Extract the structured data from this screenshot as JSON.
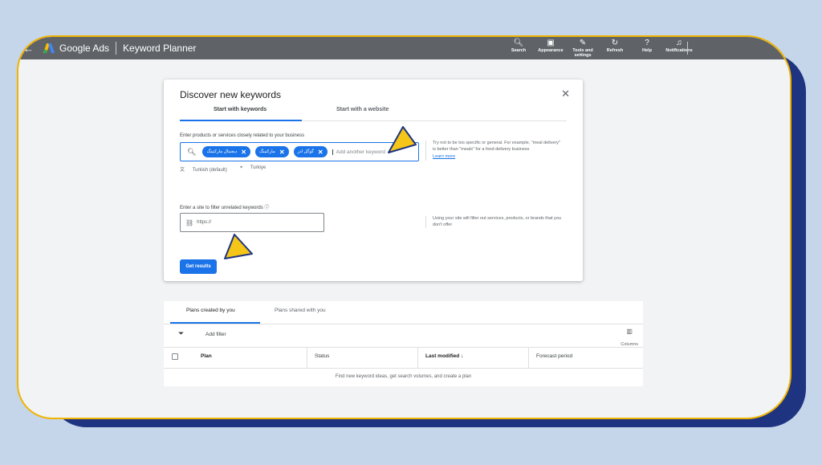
{
  "header": {
    "brand": "Google Ads",
    "product": "Keyword Planner",
    "actions": [
      {
        "icon": "search-icon",
        "label": "Search"
      },
      {
        "icon": "appearance-icon",
        "label": "Appearance"
      },
      {
        "icon": "wrench-icon",
        "label": "Tools and settings"
      },
      {
        "icon": "refresh-icon",
        "label": "Refresh"
      },
      {
        "icon": "help-icon",
        "label": "Help"
      },
      {
        "icon": "bell-icon",
        "label": "Notifications"
      }
    ]
  },
  "dialog": {
    "title": "Discover new keywords",
    "tabs": [
      "Start with keywords",
      "Start with a website"
    ],
    "products_label": "Enter products or services closely related to your business",
    "chips": [
      "دیجیتال مارکتینگ",
      "مارکتینگ",
      "گوگل ادز"
    ],
    "keyword_placeholder": "Add another keyword",
    "language": "Turkish (default)",
    "location": "Turkiye",
    "hint1": "Try not to be too specific or general. For example, \"meal delivery\" is better than \"meals\" for a food delivery business",
    "learn_more": "Learn more",
    "site_label": "Enter a site to filter unrelated keywords",
    "site_placeholder": "https://",
    "hint2": "Using your site will filter out services, products, or brands that you don't offer",
    "get_results": "Get results"
  },
  "plans": {
    "tabs": [
      "Plans created by you",
      "Plans shared with you"
    ],
    "add_filter": "Add filter",
    "columns_label": "Columns",
    "headers": [
      "Plan",
      "Status",
      "Last modified",
      "Forecast period"
    ],
    "empty_message": "Find new keyword ideas, get search volumes, and create a plan"
  },
  "colors": {
    "accent": "#1a73e8",
    "topbar": "#5f6368",
    "arrow": "#f5c518",
    "frame_border": "#f0b400",
    "backplate": "#1e3480"
  }
}
